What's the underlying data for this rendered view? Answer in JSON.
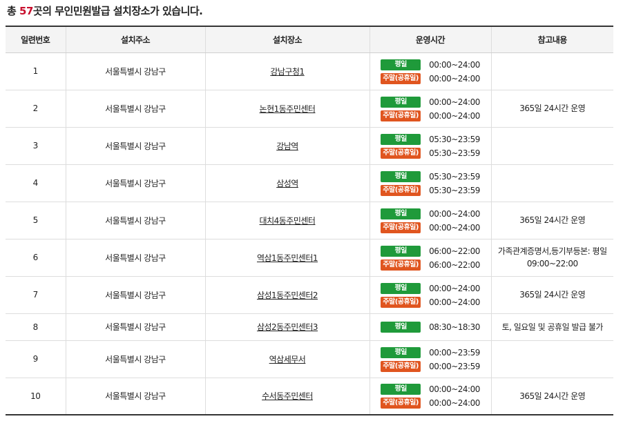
{
  "summary": {
    "prefix": "총 ",
    "count": "57",
    "suffix": "곳의 무인민원발급 설치장소가 있습니다."
  },
  "table": {
    "headers": [
      "일련번호",
      "설치주소",
      "설치장소",
      "운영시간",
      "참고내용"
    ],
    "labels": {
      "weekday": "평일",
      "weekend": "주말(공휴일)"
    },
    "rows": [
      {
        "no": "1",
        "address": "서울특별시 강남구",
        "place": "강남구청1",
        "weekday": "00:00~24:00",
        "weekend": "00:00~24:00",
        "note": ""
      },
      {
        "no": "2",
        "address": "서울특별시 강남구",
        "place": "논현1동주민센터",
        "weekday": "00:00~24:00",
        "weekend": "00:00~24:00",
        "note": "365일 24시간 운영"
      },
      {
        "no": "3",
        "address": "서울특별시 강남구",
        "place": "강남역",
        "weekday": "05:30~23:59",
        "weekend": "05:30~23:59",
        "note": ""
      },
      {
        "no": "4",
        "address": "서울특별시 강남구",
        "place": "삼성역",
        "weekday": "05:30~23:59",
        "weekend": "05:30~23:59",
        "note": ""
      },
      {
        "no": "5",
        "address": "서울특별시 강남구",
        "place": "대치4동주민센터",
        "weekday": "00:00~24:00",
        "weekend": "00:00~24:00",
        "note": "365일 24시간 운영"
      },
      {
        "no": "6",
        "address": "서울특별시 강남구",
        "place": "역삼1동주민센터1",
        "weekday": "06:00~22:00",
        "weekend": "06:00~22:00",
        "note": "가족관계증명서,등기부등본: 평일 09:00~22:00"
      },
      {
        "no": "7",
        "address": "서울특별시 강남구",
        "place": "삼성1동주민센터2",
        "weekday": "00:00~24:00",
        "weekend": "00:00~24:00",
        "note": "365일 24시간 운영"
      },
      {
        "no": "8",
        "address": "서울특별시 강남구",
        "place": "삼성2동주민센터3",
        "weekday": "08:30~18:30",
        "weekend": null,
        "note": "토, 일요일 및 공휴일 발급 불가"
      },
      {
        "no": "9",
        "address": "서울특별시 강남구",
        "place": "역삼세무서",
        "weekday": "00:00~23:59",
        "weekend": "00:00~23:59",
        "note": ""
      },
      {
        "no": "10",
        "address": "서울특별시 강남구",
        "place": "수서동주민센터",
        "weekday": "00:00~24:00",
        "weekend": "00:00~24:00",
        "note": "365일 24시간 운영"
      }
    ]
  }
}
